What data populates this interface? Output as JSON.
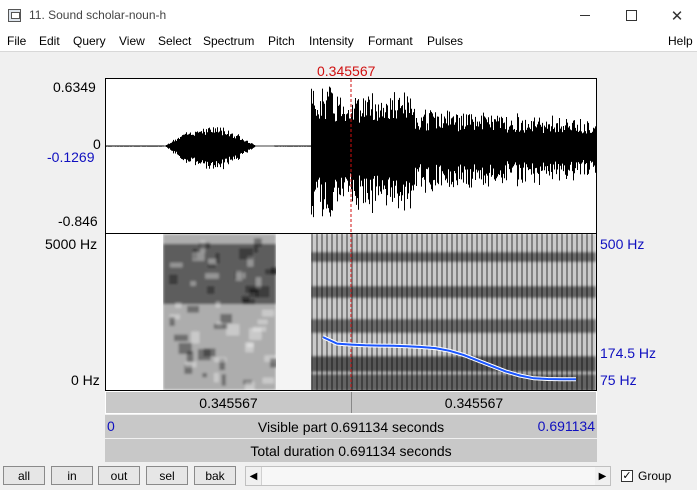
{
  "window": {
    "title": "11. Sound scholar-noun-h"
  },
  "menu": [
    "File",
    "Edit",
    "Query",
    "View",
    "Select",
    "Spectrum",
    "Pitch",
    "Intensity",
    "Formant",
    "Pulses",
    "Help"
  ],
  "cursor": {
    "time_label": "0.345567",
    "time_fraction": 0.5
  },
  "waveform": {
    "max_label": "0.6349",
    "zero_label": "0",
    "cursor_value_label": "-0.1269",
    "min_label": "-0.846"
  },
  "spectrogram": {
    "top_label": "5000 Hz",
    "bottom_label": "0 Hz"
  },
  "pitch": {
    "top_label": "500 Hz",
    "cursor_label": "174.5 Hz",
    "bottom_label": "75 Hz"
  },
  "selection": {
    "left_label": "0.345567",
    "right_label": "0.345567"
  },
  "visible": {
    "start": "0",
    "text": "Visible part 0.691134 seconds",
    "end": "0.691134"
  },
  "total": {
    "text": "Total duration 0.691134 seconds"
  },
  "toolbar": {
    "buttons": [
      "all",
      "in",
      "out",
      "sel",
      "bak"
    ],
    "group_label": "Group",
    "group_checked": "✓"
  },
  "colors": {
    "cursor": "#d01010",
    "pitch": "#1a55ff",
    "labels_blue": "#1010c0"
  }
}
